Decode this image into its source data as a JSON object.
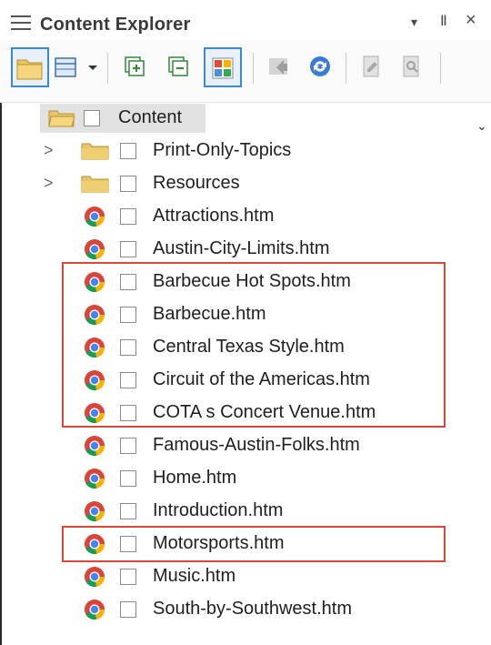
{
  "window": {
    "title": "Content Explorer",
    "menu_glyph": "▾",
    "pin_glyph": "Ⅱ",
    "close_glyph": "×"
  },
  "toolbar": {
    "overflow_glyph": "⌄"
  },
  "tree": {
    "root": {
      "label": "Content"
    },
    "items": [
      {
        "label": "Print-Only-Topics",
        "type": "folder"
      },
      {
        "label": "Resources",
        "type": "folder"
      },
      {
        "label": "Attractions.htm",
        "type": "file"
      },
      {
        "label": "Austin-City-Limits.htm",
        "type": "file"
      },
      {
        "label": "Barbecue Hot Spots.htm",
        "type": "file"
      },
      {
        "label": "Barbecue.htm",
        "type": "file"
      },
      {
        "label": "Central Texas Style.htm",
        "type": "file"
      },
      {
        "label": "Circuit of the Americas.htm",
        "type": "file"
      },
      {
        "label": "COTA s Concert Venue.htm",
        "type": "file"
      },
      {
        "label": "Famous-Austin-Folks.htm",
        "type": "file"
      },
      {
        "label": "Home.htm",
        "type": "file"
      },
      {
        "label": "Introduction.htm",
        "type": "file"
      },
      {
        "label": "Motorsports.htm",
        "type": "file"
      },
      {
        "label": "Music.htm",
        "type": "file"
      },
      {
        "label": "South-by-Southwest.htm",
        "type": "file"
      }
    ]
  },
  "colors": {
    "highlight_border": "#d9483b",
    "active_button": "#3c8ad2",
    "folder": "#e8c56a"
  }
}
